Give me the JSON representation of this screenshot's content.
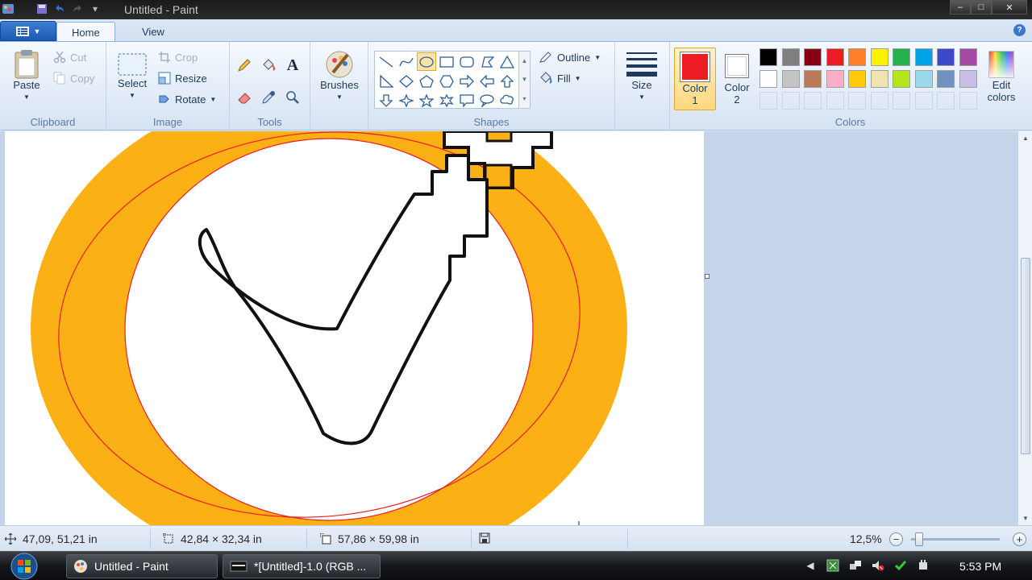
{
  "window": {
    "title": "Untitled - Paint",
    "minimize": "–",
    "maximize": "□",
    "close": "✕"
  },
  "tabs": {
    "home": "Home",
    "view": "View",
    "help": "?"
  },
  "ribbon": {
    "clipboard": {
      "label": "Clipboard",
      "paste": "Paste",
      "cut": "Cut",
      "copy": "Copy"
    },
    "image": {
      "label": "Image",
      "select": "Select",
      "crop": "Crop",
      "resize": "Resize",
      "rotate": "Rotate"
    },
    "tools": {
      "label": "Tools",
      "text_tool": "A"
    },
    "brushes": "Brushes",
    "shapes": {
      "label": "Shapes",
      "outline": "Outline",
      "fill": "Fill"
    },
    "size": "Size",
    "color1": {
      "line1": "Color",
      "line2": "1",
      "value": "#ed1c24"
    },
    "color2": {
      "line1": "Color",
      "line2": "2",
      "value": "#ffffff"
    },
    "colors": {
      "label": "Colors",
      "edit_line1": "Edit",
      "edit_line2": "colors",
      "palette": [
        "#000000",
        "#7f7f7f",
        "#880015",
        "#ed1c24",
        "#ff7f27",
        "#fff200",
        "#22b14c",
        "#00a2e8",
        "#3f48cc",
        "#a349a4",
        "#ffffff",
        "#c3c3c3",
        "#b97a57",
        "#ffaec9",
        "#ffc90e",
        "#efe4b0",
        "#b5e61d",
        "#99d9ea",
        "#7092be",
        "#c8bfe7"
      ]
    }
  },
  "canvas": {
    "accent_orange": "#fbb116",
    "ellipse_stroke": "#ed1c24"
  },
  "status": {
    "cursor_pos": "47,09, 51,21 in",
    "selection_size": "42,84 × 32,34 in",
    "image_size": "57,86 × 59,98 in",
    "zoom": "12,5%",
    "zoom_out": "−",
    "zoom_in": "+"
  },
  "taskbar": {
    "task1": "Untitled - Paint",
    "task2": "*[Untitled]-1.0 (RGB ...",
    "clock": "5:53 PM"
  }
}
